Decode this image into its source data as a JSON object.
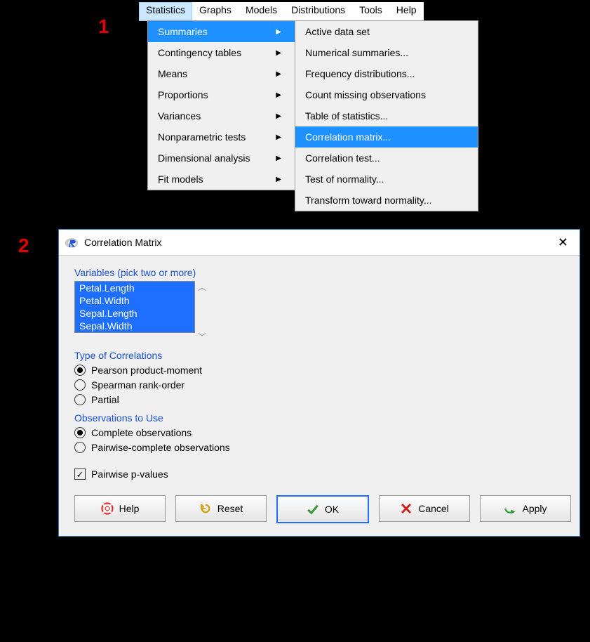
{
  "annotations": {
    "one": "1",
    "two": "2"
  },
  "menubar": {
    "items": [
      "Statistics",
      "Graphs",
      "Models",
      "Distributions",
      "Tools",
      "Help"
    ],
    "activeIndex": 0
  },
  "submenu1": {
    "items": [
      {
        "label": "Summaries",
        "hasSubmenu": true,
        "highlight": true
      },
      {
        "label": "Contingency tables",
        "hasSubmenu": true
      },
      {
        "label": "Means",
        "hasSubmenu": true
      },
      {
        "label": "Proportions",
        "hasSubmenu": true
      },
      {
        "label": "Variances",
        "hasSubmenu": true
      },
      {
        "label": "Nonparametric tests",
        "hasSubmenu": true
      },
      {
        "label": "Dimensional analysis",
        "hasSubmenu": true
      },
      {
        "label": "Fit models",
        "hasSubmenu": true
      }
    ]
  },
  "submenu2": {
    "items": [
      {
        "label": "Active data set"
      },
      {
        "label": "Numerical summaries..."
      },
      {
        "label": "Frequency distributions..."
      },
      {
        "label": "Count missing observations"
      },
      {
        "label": "Table of statistics..."
      },
      {
        "label": "Correlation matrix...",
        "highlight": true
      },
      {
        "label": "Correlation test..."
      },
      {
        "label": "Test of normality..."
      },
      {
        "label": "Transform toward normality..."
      }
    ]
  },
  "dialog": {
    "title": "Correlation Matrix",
    "variables_label": "Variables (pick two or more)",
    "variables": [
      "Petal.Length",
      "Petal.Width",
      "Sepal.Length",
      "Sepal.Width"
    ],
    "type_label": "Type of Correlations",
    "type_options": [
      "Pearson product-moment",
      "Spearman rank-order",
      "Partial"
    ],
    "type_selected": 0,
    "obs_label": "Observations to Use",
    "obs_options": [
      "Complete observations",
      "Pairwise-complete observations"
    ],
    "obs_selected": 0,
    "pvalues_label": "Pairwise p-values",
    "pvalues_checked": true,
    "buttons": {
      "help": "Help",
      "reset": "Reset",
      "ok": "OK",
      "cancel": "Cancel",
      "apply": "Apply"
    }
  }
}
